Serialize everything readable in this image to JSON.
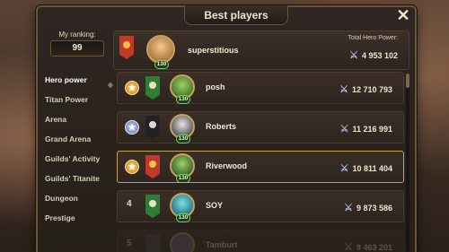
{
  "window": {
    "title": "Best players"
  },
  "ranking": {
    "label": "My ranking:",
    "value": "99"
  },
  "me": {
    "name": "superstitious",
    "level": "130",
    "power_label": "Total Hero Power:",
    "power": "4 953 102",
    "banner_color": "#c0392b"
  },
  "sidebar": {
    "items": [
      {
        "label": "Hero power"
      },
      {
        "label": "Titan Power"
      },
      {
        "label": "Arena"
      },
      {
        "label": "Grand Arena"
      },
      {
        "label": "Guilds' Activity"
      },
      {
        "label": "Guilds' Titanite"
      },
      {
        "label": "Dungeon"
      },
      {
        "label": "Prestige"
      }
    ]
  },
  "players": [
    {
      "rank": "",
      "medal": "gold",
      "name": "posh",
      "level": "130",
      "power": "12 710 793",
      "banner_color": "#2f7d32",
      "banner_text": ""
    },
    {
      "rank": "",
      "medal": "silver",
      "name": "Roberts",
      "level": "130",
      "power": "11 216 991",
      "banner_color": "#222222",
      "banner_text": ""
    },
    {
      "rank": "",
      "medal": "gold",
      "name": "Riverwood",
      "level": "130",
      "power": "10 811 404",
      "banner_color": "#c0392b",
      "banner_text": ""
    },
    {
      "rank": "4",
      "medal": "",
      "name": "SOY",
      "level": "130",
      "power": "9 873 586",
      "banner_color": "#2f7d32",
      "banner_text": ""
    },
    {
      "rank": "5",
      "medal": "",
      "name": "Tamburt",
      "level": "130",
      "power": "9 463 201",
      "banner_color": "#4a4a4a",
      "banner_text": ""
    }
  ],
  "colors": {
    "accent": "#c9a14f",
    "panel": "#2e2622",
    "border": "#6b5334"
  }
}
